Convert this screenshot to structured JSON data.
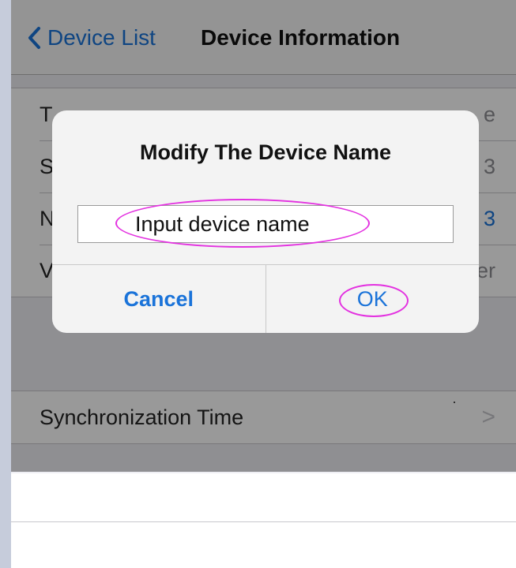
{
  "nav": {
    "back_label": "Device List",
    "title": "Device Information"
  },
  "info_rows": [
    {
      "label": "T",
      "value": "e"
    },
    {
      "label": "S",
      "value": "3"
    },
    {
      "label": "N",
      "value": "3"
    },
    {
      "label": "Validity",
      "value": "Forever"
    }
  ],
  "sync_row": {
    "label": "Synchronization Time",
    "chevron": ">"
  },
  "dialog": {
    "title": "Modify The Device Name",
    "input_placeholder": "Input device name",
    "input_value": "",
    "cancel_label": "Cancel",
    "ok_label": "OK"
  },
  "icons": {
    "back": "chevron-left-icon",
    "row_disclosure": "chevron-right-icon"
  },
  "colors": {
    "accent": "#1a73d9",
    "annotation": "#e331e0",
    "nav_background": "#f7f7f7",
    "grouped_background": "#efeff4"
  }
}
